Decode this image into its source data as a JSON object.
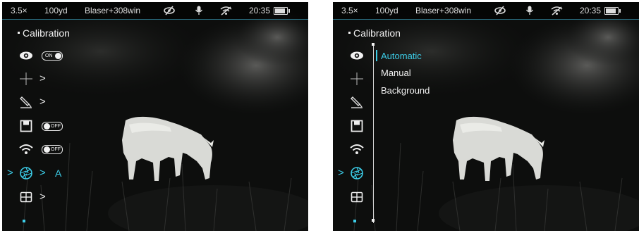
{
  "status": {
    "zoom": "3.5×",
    "range": "100yd",
    "profile": "Blaser+308win",
    "time": "20:35",
    "icons": [
      "eye-off-icon",
      "microphone-icon",
      "wifi-off-icon",
      "battery-icon"
    ],
    "battery_level": 0.8
  },
  "colors": {
    "accent": "#3ccde8",
    "text": "#f2f2f2"
  },
  "left_screen": {
    "title": "Calibration",
    "items": [
      {
        "icon": "eye-icon",
        "toggle": "ON",
        "toggle_on": true
      },
      {
        "icon": "crosshair-icon",
        "chevron": ">"
      },
      {
        "icon": "ruler-pen-icon",
        "chevron": ">"
      },
      {
        "icon": "save-icon",
        "toggle": "OFF",
        "toggle_on": false
      },
      {
        "icon": "wifi-icon",
        "toggle": "OFF",
        "toggle_on": false
      },
      {
        "icon": "calibration-aperture-icon",
        "chevron": ">",
        "value": "A",
        "selected": true,
        "selected_marker": ">"
      },
      {
        "icon": "grid-settings-icon",
        "chevron": ">"
      }
    ]
  },
  "right_screen": {
    "title": "Calibration",
    "selected_marker": ">",
    "submenu": [
      {
        "label": "Automatic",
        "active": true
      },
      {
        "label": "Manual",
        "active": false
      },
      {
        "label": "Background",
        "active": false
      }
    ]
  }
}
